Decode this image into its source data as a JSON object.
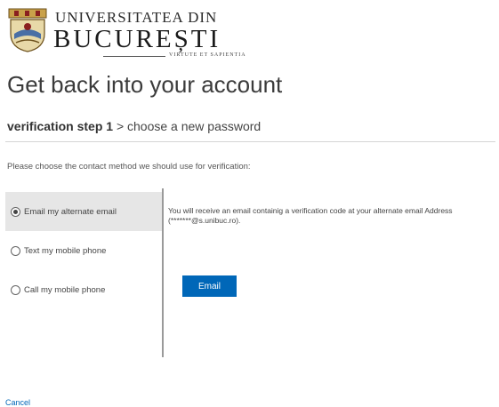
{
  "logo": {
    "line1": "UNIVERSITATEA DIN",
    "line2": "BUCUREȘTI",
    "motto": "VIRTUTE ET SAPIENTIA"
  },
  "page": {
    "heading": "Get back into your account"
  },
  "steps": {
    "current": "verification step 1",
    "separator": ">",
    "next": "choose a new password"
  },
  "instruction": "Please choose the contact method we should use for verification:",
  "options": [
    {
      "label": "Email my alternate email",
      "selected": true
    },
    {
      "label": "Text my mobile phone",
      "selected": false
    },
    {
      "label": "Call my mobile phone",
      "selected": false
    }
  ],
  "detail": {
    "text": "You will receive an email containig a verification code at your alternate email Address (*******@s.unibuc.ro)."
  },
  "actions": {
    "email_button": "Email",
    "cancel_link": "Cancel"
  },
  "colors": {
    "accent": "#0067b8",
    "selected_bg": "#e6e6e6"
  }
}
